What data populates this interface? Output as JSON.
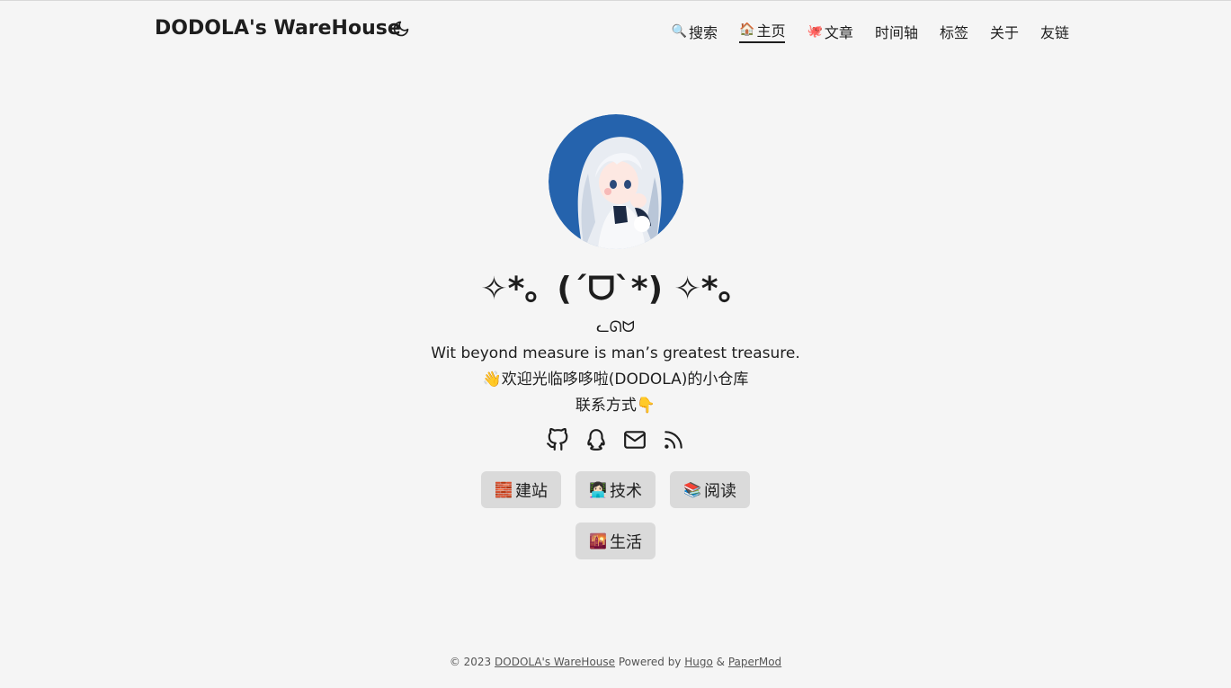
{
  "header": {
    "site_title": "DODOLA's WareHouse",
    "theme_icon": "moon-icon",
    "nav": [
      {
        "emoji": "🔍",
        "label": "搜索",
        "active": false
      },
      {
        "emoji": "🏠",
        "label": "主页",
        "active": true
      },
      {
        "emoji": "🐙",
        "label": "文章",
        "active": false
      },
      {
        "emoji": "",
        "label": "时间轴",
        "active": false
      },
      {
        "emoji": "",
        "label": "标签",
        "active": false
      },
      {
        "emoji": "",
        "label": "关于",
        "active": false
      },
      {
        "emoji": "",
        "label": "友链",
        "active": false
      }
    ]
  },
  "profile": {
    "avatar_alt": "anime-girl-avatar",
    "title": "✧*。(ˊᗜˋ*) ✧*。",
    "subtitle": "ᓚᘏᗢ",
    "motto": "Wit beyond measure is man’s greatest treasure.",
    "welcome": "👋欢迎光临哆哆啦(DODOLA)的小仓库",
    "contact": "联系方式👇",
    "social": [
      "github-icon",
      "qq-icon",
      "email-icon",
      "rss-icon"
    ],
    "buttons": [
      {
        "emoji": "🧱",
        "label": "建站"
      },
      {
        "emoji": "👩🏻‍💻",
        "label": "技术"
      },
      {
        "emoji": "📚",
        "label": "阅读"
      },
      {
        "emoji": "🌇",
        "label": "生活"
      }
    ]
  },
  "footer": {
    "copyright": "© 2023",
    "site_link": "DODOLA's WareHouse",
    "powered": "Powered by",
    "hugo": "Hugo",
    "amp": "&",
    "papermod": "PaperMod"
  },
  "colors": {
    "background": "#f5f5f5",
    "button_bg": "#dadada",
    "avatar_bg": "#2563ad",
    "text": "#1e1e1e"
  }
}
